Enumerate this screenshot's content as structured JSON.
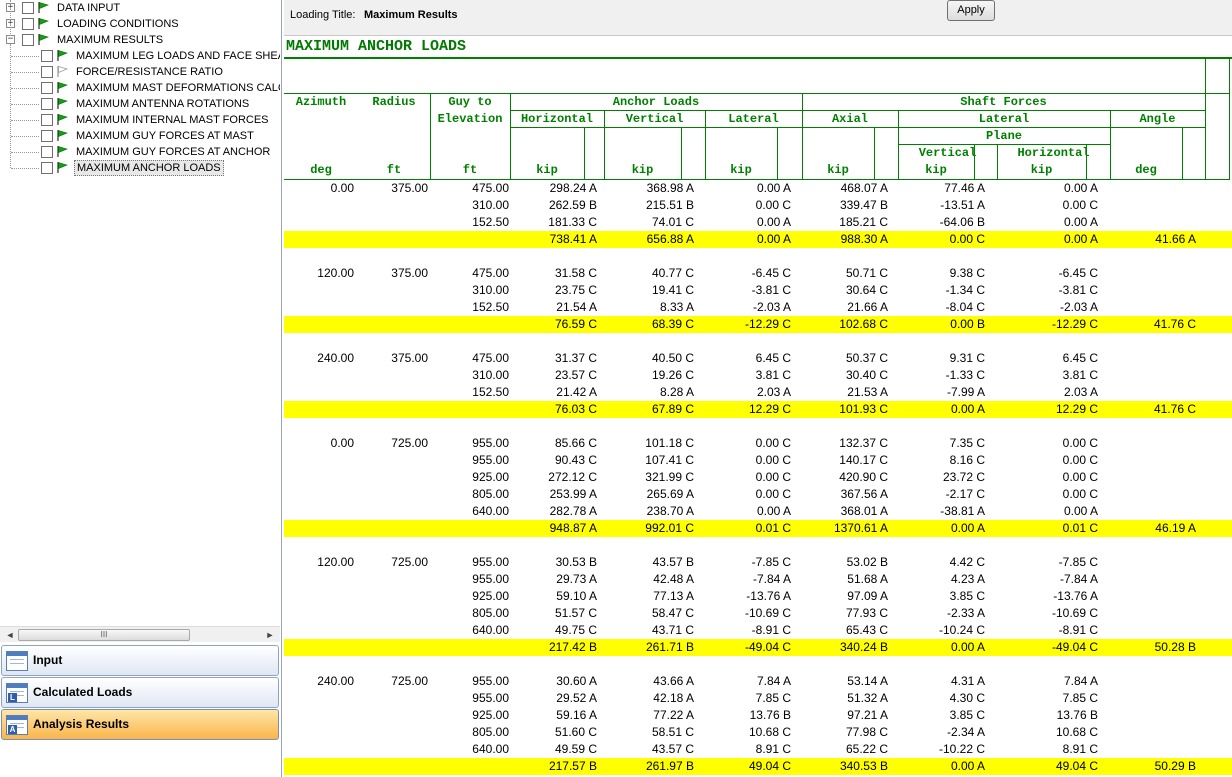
{
  "colors": {
    "header_green": "#008000",
    "highlight_yellow": "#ffff00",
    "active_nav": "#f9b54a"
  },
  "tree": [
    {
      "label": "DATA INPUT",
      "level": 0,
      "expander": "+",
      "flag": "green-flag-icon"
    },
    {
      "label": "LOADING CONDITIONS",
      "level": 0,
      "expander": "+",
      "flag": "green-flag-icon"
    },
    {
      "label": "MAXIMUM RESULTS",
      "level": 0,
      "expander": "−",
      "flag": "green-flag-icon"
    },
    {
      "label": "MAXIMUM LEG LOADS AND FACE SHEAR",
      "level": 1,
      "flag": "green-flag-icon"
    },
    {
      "label": "FORCE/RESISTANCE RATIO",
      "level": 1,
      "flag": "outline-flag-icon"
    },
    {
      "label": "MAXIMUM MAST DEFORMATIONS CALCUL",
      "level": 1,
      "flag": "green-flag-icon"
    },
    {
      "label": "MAXIMUM ANTENNA ROTATIONS",
      "level": 1,
      "flag": "green-flag-icon"
    },
    {
      "label": "MAXIMUM INTERNAL MAST FORCES",
      "level": 1,
      "flag": "green-flag-icon"
    },
    {
      "label": "MAXIMUM GUY FORCES AT MAST",
      "level": 1,
      "flag": "green-flag-icon"
    },
    {
      "label": "MAXIMUM GUY FORCES AT ANCHOR",
      "level": 1,
      "flag": "green-flag-icon"
    },
    {
      "label": "MAXIMUM ANCHOR LOADS",
      "level": 1,
      "flag": "green-flag-icon",
      "selected": true
    }
  ],
  "scrollbar": {
    "left": "◄",
    "right": "►",
    "grip": "III"
  },
  "nav": [
    {
      "label": "Input",
      "icon": "table-icon",
      "letter": ""
    },
    {
      "label": "Calculated Loads",
      "icon": "table-l-icon",
      "letter": "L"
    },
    {
      "label": "Analysis Results",
      "icon": "table-a-icon",
      "letter": "A",
      "active": true
    }
  ],
  "header": {
    "loading_title_label": "Loading Title:",
    "loading_title_value": "Maximum Results",
    "apply_label": "Apply"
  },
  "report": {
    "title": "MAXIMUM ANCHOR LOADS",
    "headers": {
      "azimuth": "Azimuth",
      "radius": "Radius",
      "guy_to": "Guy to",
      "elevation": "Elevation",
      "anchor_loads": "Anchor Loads",
      "horizontal": "Horizontal",
      "vertical": "Vertical",
      "lateral": "Lateral",
      "shaft_forces": "Shaft Forces",
      "axial": "Axial",
      "shaft_lateral": "Lateral",
      "angle": "Angle",
      "plane": "Plane",
      "plane_vertical": "Vertical",
      "plane_horizontal": "Horizontal"
    },
    "units": [
      "deg",
      "ft",
      "ft",
      "kip",
      "kip",
      "kip",
      "kip",
      "kip",
      "kip",
      "deg"
    ],
    "groups": [
      {
        "rows": [
          [
            "0.00",
            "375.00",
            "475.00",
            "298.24 A",
            "368.98 A",
            "0.00 A",
            "468.07 A",
            "77.46 A",
            "0.00 A",
            ""
          ],
          [
            "",
            "",
            "310.00",
            "262.59 B",
            "215.51 B",
            "0.00 C",
            "339.47 B",
            "-13.51 A",
            "0.00 C",
            ""
          ],
          [
            "",
            "",
            "152.50",
            "181.33 C",
            "74.01 C",
            "0.00 A",
            "185.21 C",
            "-64.06 B",
            "0.00 A",
            ""
          ]
        ],
        "total": [
          "",
          "",
          "",
          "738.41 A",
          "656.88 A",
          "0.00 A",
          "988.30 A",
          "0.00 C",
          "0.00 A",
          "41.66 A"
        ]
      },
      {
        "rows": [
          [
            "120.00",
            "375.00",
            "475.00",
            "31.58 C",
            "40.77 C",
            "-6.45 C",
            "50.71 C",
            "9.38 C",
            "-6.45 C",
            ""
          ],
          [
            "",
            "",
            "310.00",
            "23.75 C",
            "19.41 C",
            "-3.81 C",
            "30.64 C",
            "-1.34 C",
            "-3.81 C",
            ""
          ],
          [
            "",
            "",
            "152.50",
            "21.54 A",
            "8.33 A",
            "-2.03 A",
            "21.66 A",
            "-8.04 C",
            "-2.03 A",
            ""
          ]
        ],
        "total": [
          "",
          "",
          "",
          "76.59 C",
          "68.39 C",
          "-12.29 C",
          "102.68 C",
          "0.00 B",
          "-12.29 C",
          "41.76 C"
        ]
      },
      {
        "rows": [
          [
            "240.00",
            "375.00",
            "475.00",
            "31.37 C",
            "40.50 C",
            "6.45 C",
            "50.37 C",
            "9.31 C",
            "6.45 C",
            ""
          ],
          [
            "",
            "",
            "310.00",
            "23.57 C",
            "19.26 C",
            "3.81 C",
            "30.40 C",
            "-1.33 C",
            "3.81 C",
            ""
          ],
          [
            "",
            "",
            "152.50",
            "21.42 A",
            "8.28 A",
            "2.03 A",
            "21.53 A",
            "-7.99 A",
            "2.03 A",
            ""
          ]
        ],
        "total": [
          "",
          "",
          "",
          "76.03 C",
          "67.89 C",
          "12.29 C",
          "101.93 C",
          "0.00 A",
          "12.29 C",
          "41.76 C"
        ]
      },
      {
        "rows": [
          [
            "0.00",
            "725.00",
            "955.00",
            "85.66 C",
            "101.18 C",
            "0.00 C",
            "132.37 C",
            "7.35 C",
            "0.00 C",
            ""
          ],
          [
            "",
            "",
            "955.00",
            "90.43 C",
            "107.41 C",
            "0.00 C",
            "140.17 C",
            "8.16 C",
            "0.00 C",
            ""
          ],
          [
            "",
            "",
            "925.00",
            "272.12 C",
            "321.99 C",
            "0.00 C",
            "420.90 C",
            "23.72 C",
            "0.00 C",
            ""
          ],
          [
            "",
            "",
            "805.00",
            "253.99 A",
            "265.69 A",
            "0.00 C",
            "367.56 A",
            "-2.17 C",
            "0.00 C",
            ""
          ],
          [
            "",
            "",
            "640.00",
            "282.78 A",
            "238.70 A",
            "0.00 A",
            "368.01 A",
            "-38.81 A",
            "0.00 A",
            ""
          ]
        ],
        "total": [
          "",
          "",
          "",
          "948.87 A",
          "992.01 C",
          "0.01 C",
          "1370.61 A",
          "0.00 A",
          "0.01 C",
          "46.19 A"
        ]
      },
      {
        "rows": [
          [
            "120.00",
            "725.00",
            "955.00",
            "30.53 B",
            "43.57 B",
            "-7.85 C",
            "53.02 B",
            "4.42 C",
            "-7.85 C",
            ""
          ],
          [
            "",
            "",
            "955.00",
            "29.73 A",
            "42.48 A",
            "-7.84 A",
            "51.68 A",
            "4.23 A",
            "-7.84 A",
            ""
          ],
          [
            "",
            "",
            "925.00",
            "59.10 A",
            "77.13 A",
            "-13.76 A",
            "97.09 A",
            "3.85 C",
            "-13.76 A",
            ""
          ],
          [
            "",
            "",
            "805.00",
            "51.57 C",
            "58.47 C",
            "-10.69 C",
            "77.93 C",
            "-2.33 A",
            "-10.69 C",
            ""
          ],
          [
            "",
            "",
            "640.00",
            "49.75 C",
            "43.71 C",
            "-8.91 C",
            "65.43 C",
            "-10.24 C",
            "-8.91 C",
            ""
          ]
        ],
        "total": [
          "",
          "",
          "",
          "217.42 B",
          "261.71 B",
          "-49.04 C",
          "340.24 B",
          "0.00 A",
          "-49.04 C",
          "50.28 B"
        ]
      },
      {
        "rows": [
          [
            "240.00",
            "725.00",
            "955.00",
            "30.60 A",
            "43.66 A",
            "7.84 A",
            "53.14 A",
            "4.31 A",
            "7.84 A",
            ""
          ],
          [
            "",
            "",
            "955.00",
            "29.52 A",
            "42.18 A",
            "7.85 C",
            "51.32 A",
            "4.30 C",
            "7.85 C",
            ""
          ],
          [
            "",
            "",
            "925.00",
            "59.16 A",
            "77.22 A",
            "13.76 B",
            "97.21 A",
            "3.85 C",
            "13.76 B",
            ""
          ],
          [
            "",
            "",
            "805.00",
            "51.60 C",
            "58.51 C",
            "10.68 C",
            "77.98 C",
            "-2.34 A",
            "10.68 C",
            ""
          ],
          [
            "",
            "",
            "640.00",
            "49.59 C",
            "43.57 C",
            "8.91 C",
            "65.22 C",
            "-10.22 C",
            "8.91 C",
            ""
          ]
        ],
        "total": [
          "",
          "",
          "",
          "217.57 B",
          "261.97 B",
          "49.04 C",
          "340.53 B",
          "0.00 A",
          "49.04 C",
          "50.29 B"
        ]
      }
    ]
  }
}
